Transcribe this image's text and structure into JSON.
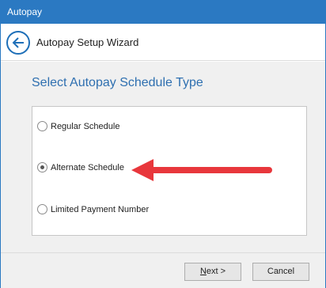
{
  "window": {
    "title": "Autopay"
  },
  "header": {
    "back_icon": "back-arrow-icon",
    "title": "Autopay Setup Wizard"
  },
  "main": {
    "heading": "Select Autopay Schedule Type",
    "options": [
      {
        "label": "Regular Schedule",
        "checked": false
      },
      {
        "label": "Alternate Schedule",
        "checked": true
      },
      {
        "label": "Limited Payment Number",
        "checked": false
      }
    ],
    "annotation": {
      "icon": "red-pointer-arrow",
      "color": "#e8373c"
    }
  },
  "footer": {
    "next_mnemonic": "N",
    "next_rest": "ext >",
    "cancel_label": "Cancel"
  },
  "colors": {
    "titlebar": "#2b79c2",
    "heading": "#2e6fb0",
    "arrow": "#e8373c"
  }
}
